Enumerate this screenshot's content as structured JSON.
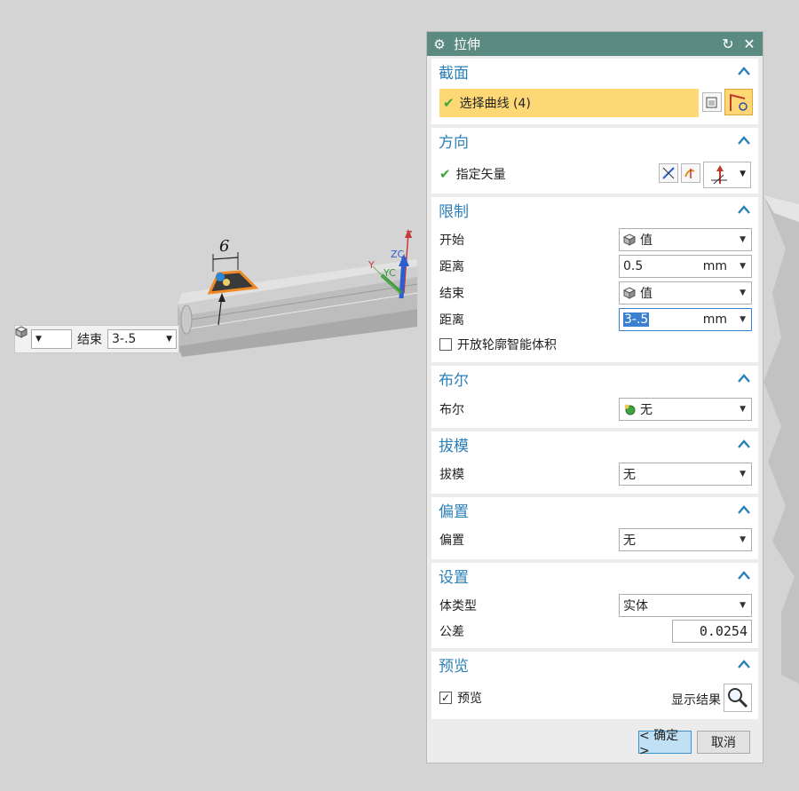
{
  "viewport": {
    "dimension_label": "6",
    "axis_labels": {
      "z": "Z",
      "zc": "ZC",
      "yc": "YC",
      "y": "Y"
    },
    "mini_toolbar": {
      "end_label": "结束",
      "end_value": "3-.5"
    }
  },
  "dialog": {
    "title": "拉伸",
    "sections": {
      "section": {
        "header": "截面",
        "select_curve": "选择曲线 (4)"
      },
      "direction": {
        "header": "方向",
        "specify_vector": "指定矢量"
      },
      "limits": {
        "header": "限制",
        "start_label": "开始",
        "start_value": "值",
        "distance1_label": "距离",
        "distance1_value": "0.5",
        "distance1_unit": "mm",
        "end_label": "结束",
        "end_value": "值",
        "distance2_label": "距离",
        "distance2_value": "3-.5",
        "distance2_unit": "mm",
        "open_profile_label": "开放轮廓智能体积"
      },
      "boolean": {
        "header": "布尔",
        "label": "布尔",
        "value": "无"
      },
      "draft": {
        "header": "拔模",
        "label": "拔模",
        "value": "无"
      },
      "offset": {
        "header": "偏置",
        "label": "偏置",
        "value": "无"
      },
      "settings": {
        "header": "设置",
        "body_type_label": "体类型",
        "body_type_value": "实体",
        "tolerance_label": "公差",
        "tolerance_value": "0.0254"
      },
      "preview": {
        "header": "预览",
        "preview_label": "预览",
        "show_result_label": "显示结果"
      }
    },
    "buttons": {
      "ok": "< 确定 >",
      "cancel": "取消"
    }
  },
  "colors": {
    "titlebar": "#5a8a80",
    "section_header": "#2b80b8",
    "selection_highlight": "#fdd875",
    "check_green": "#3da53d"
  }
}
